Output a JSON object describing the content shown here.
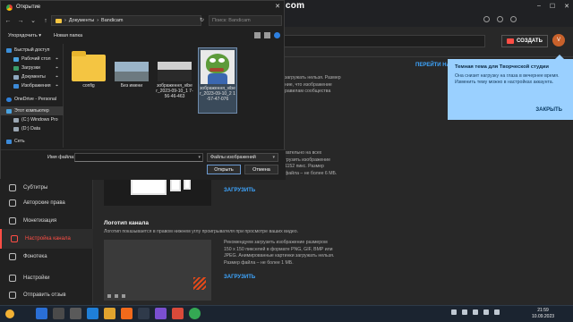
{
  "watermark": "www.BANDICAM.com",
  "dialog": {
    "title": "Открытие",
    "path": [
      "Документы",
      "Bandicam"
    ],
    "search_placeholder": "Поиск: Bandicam",
    "cmd": {
      "organize": "Упорядочить ▾",
      "new_folder": "Новая папка"
    },
    "tree": [
      {
        "label": "Быстрый доступ",
        "icon": "star-icon"
      },
      {
        "label": "Рабочий стол",
        "icon": "desktop-icon",
        "pinned": true
      },
      {
        "label": "Загрузки",
        "icon": "download-icon",
        "pinned": true
      },
      {
        "label": "Документы",
        "icon": "document-icon",
        "pinned": true
      },
      {
        "label": "Изображения",
        "icon": "pictures-icon",
        "pinned": true
      },
      {
        "label": "OneDrive - Personal",
        "icon": "cloud-icon"
      },
      {
        "label": "Этот компьютер",
        "icon": "computer-icon",
        "selected": true
      },
      {
        "label": "(C:) Windows Pro",
        "icon": "drive-icon"
      },
      {
        "label": "(D:) Data",
        "icon": "drive-icon"
      },
      {
        "label": "Сеть",
        "icon": "network-icon"
      }
    ],
    "files": [
      {
        "name": "config",
        "type": "folder"
      },
      {
        "name": "Без имени",
        "type": "pic1"
      },
      {
        "name": "зображення_vibe r_2023-09-10_1 7-56-46-463",
        "type": "pic2"
      },
      {
        "name": "зображення_vibe r_2023-09-10_2 1-57-47-076",
        "type": "pepe",
        "selected": true
      }
    ],
    "filename_label": "Имя файла:",
    "filename_value": "",
    "filetype": "Файлы изображений",
    "open_label": "Открыть",
    "cancel_label": "Отмена"
  },
  "studio": {
    "create_label": "СОЗДАТЬ",
    "avatar_letter": "V",
    "tab_link": "ПЕРЕЙТИ НА",
    "sidebar": [
      {
        "label": "Субтитры",
        "icon": "subtitles-icon"
      },
      {
        "label": "Авторские права",
        "icon": "copyright-icon"
      },
      {
        "label": "Монетизация",
        "icon": "money-icon"
      },
      {
        "label": "Настройка канала",
        "icon": "customization-icon",
        "active": true
      },
      {
        "label": "Фонотека",
        "icon": "audio-library-icon"
      },
      {
        "label": "Настройки",
        "icon": "settings-icon"
      },
      {
        "label": "Отправить отзыв",
        "icon": "feedback-icon"
      }
    ],
    "top_text": [
      "загружать нельзя. Размер",
      "ние, что изображение",
      "равилам сообщества"
    ],
    "banner_text": [
      "вательно на всех",
      "грузить изображение",
      "1152 пикс. Размер",
      "файла – не более 6 МБ."
    ],
    "upload_label": "ЗАГРУЗИТЬ",
    "logo_title": "Логотип канала",
    "logo_desc": "Логотип показывается в правом нижнем углу проигрывателя при просмотре ваших видео.",
    "logo_text": [
      "Рекомендуем загрузить изображение размером",
      "150 x 150 пикселей в формате PNG, GIF, BMP или",
      "JPEG. Анимированные картинки загружать нельзя.",
      "Размер файла – не более 1 МБ."
    ]
  },
  "tip": {
    "title": "Темная тема для Творческой студии",
    "text": "Она снизит нагрузку на глаза в вечернее время. Изменить тему можно в настройках аккаунта.",
    "button": "ЗАКРЫТЬ"
  },
  "taskbar": {
    "time": "21:59",
    "date": "10.09.2023"
  }
}
